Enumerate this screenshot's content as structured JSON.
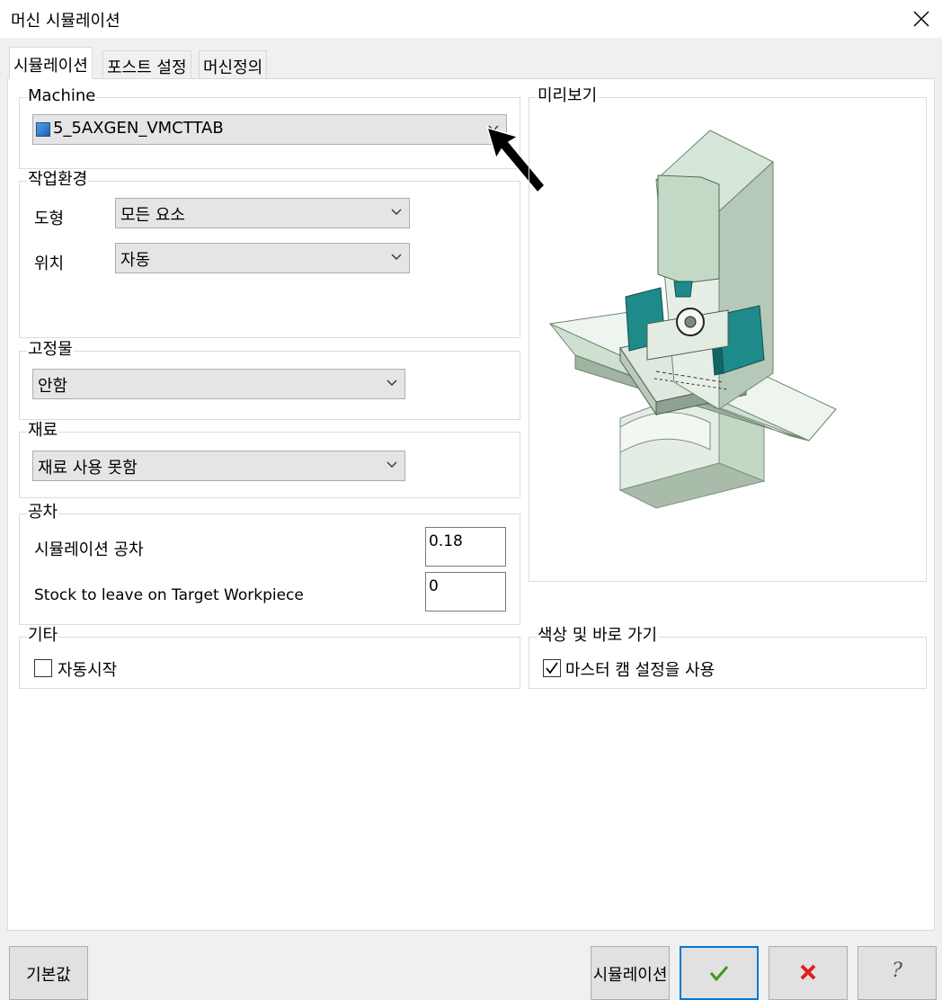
{
  "window": {
    "title": "머신 시뮬레이션"
  },
  "tabs": [
    {
      "label": "시뮬레이션",
      "active": true
    },
    {
      "label": "포스트 설정",
      "active": false
    },
    {
      "label": "머신정의",
      "active": false
    }
  ],
  "machine_group": {
    "label": "Machine",
    "selected": "5_5AXGEN_VMCTTAB"
  },
  "environment_group": {
    "label": "작업환경",
    "geometry_label": "도형",
    "geometry_value": "모든 요소",
    "position_label": "위치",
    "position_value": "자동"
  },
  "fixture_group": {
    "label": "고정물",
    "value": "안함"
  },
  "material_group": {
    "label": "재료",
    "value": "재료 사용 못함"
  },
  "tolerance_group": {
    "label": "공차",
    "sim_tol_label": "시뮬레이션 공차",
    "sim_tol_value": "0.18",
    "stock_label": "Stock to leave on Target Workpiece",
    "stock_value": "0"
  },
  "misc_group": {
    "label": "기타",
    "autostart_label": "자동시작",
    "autostart_checked": false
  },
  "preview_group": {
    "label": "미리보기"
  },
  "color_group": {
    "label": "색상 및 바로 가기",
    "use_master_label": "마스터 캠 설정을 사용",
    "use_master_checked": true
  },
  "buttons": {
    "defaults_label": "기본값",
    "simulate_label": "시뮬레이션",
    "ok_icon": "green-check-icon",
    "cancel_icon": "red-x-icon",
    "help_icon": "question-mark-icon"
  },
  "colors": {
    "accent": "#0078d7",
    "machine_teal": "#1f8a8a",
    "machine_green": "#c9dccb",
    "ok_green": "#3a9a1a",
    "cancel_red": "#e21c1c"
  }
}
